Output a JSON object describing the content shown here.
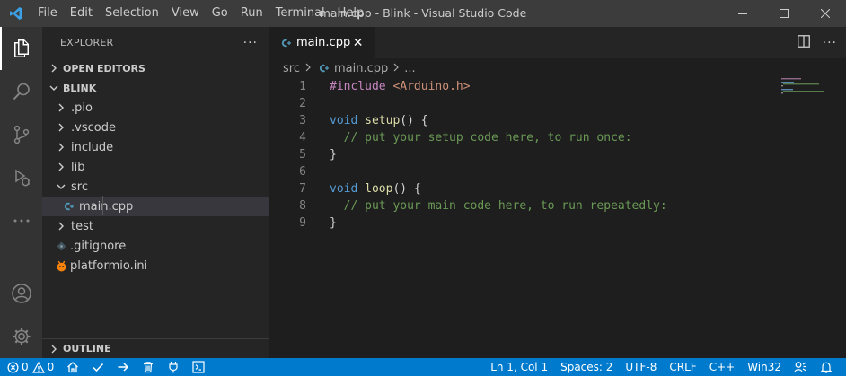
{
  "titlebar": {
    "menus": [
      "File",
      "Edit",
      "Selection",
      "View",
      "Go",
      "Run",
      "Terminal",
      "Help"
    ],
    "window_title": "main.cpp - Blink - Visual Studio Code"
  },
  "sidebar": {
    "title": "EXPLORER",
    "open_editors_label": "OPEN EDITORS",
    "workspace_label": "BLINK",
    "tree": [
      {
        "label": ".pio",
        "kind": "folder",
        "expanded": false,
        "depth": 1
      },
      {
        "label": ".vscode",
        "kind": "folder",
        "expanded": false,
        "depth": 1
      },
      {
        "label": "include",
        "kind": "folder",
        "expanded": false,
        "depth": 1
      },
      {
        "label": "lib",
        "kind": "folder",
        "expanded": false,
        "depth": 1
      },
      {
        "label": "src",
        "kind": "folder",
        "expanded": true,
        "depth": 1
      },
      {
        "label": "main.cpp",
        "kind": "cpp-file",
        "selected": true,
        "depth": 2
      },
      {
        "label": "test",
        "kind": "folder",
        "expanded": false,
        "depth": 1
      },
      {
        "label": ".gitignore",
        "kind": "gitignore-file",
        "depth": 1
      },
      {
        "label": "platformio.ini",
        "kind": "platformio-file",
        "depth": 1
      }
    ],
    "outline_label": "OUTLINE"
  },
  "editor": {
    "tab_label": "main.cpp",
    "breadcrumb": {
      "folder": "src",
      "file": "main.cpp",
      "tail": "..."
    },
    "lines": [
      {
        "n": "1",
        "text": "#include <Arduino.h>"
      },
      {
        "n": "2",
        "text": ""
      },
      {
        "n": "3",
        "text": "void setup() {"
      },
      {
        "n": "4",
        "text": "  // put your setup code here, to run once:"
      },
      {
        "n": "5",
        "text": "}"
      },
      {
        "n": "6",
        "text": ""
      },
      {
        "n": "7",
        "text": "void loop() {"
      },
      {
        "n": "8",
        "text": "  // put your main code here, to run repeatedly:"
      },
      {
        "n": "9",
        "text": "}"
      }
    ]
  },
  "statusbar": {
    "errors": "0",
    "warnings": "0",
    "cursor": "Ln 1, Col 1",
    "spaces": "Spaces: 2",
    "encoding": "UTF-8",
    "eol": "CRLF",
    "language": "C++",
    "platform": "Win32"
  },
  "colors": {
    "accent": "#007acc",
    "titlebar": "#3c3c3c",
    "activitybar": "#333333",
    "sidebar": "#252526",
    "editor": "#1e1e1e",
    "keyword": "#569cd6",
    "function": "#dcdcaa",
    "comment": "#6a9955",
    "string": "#ce9178",
    "preprocessor": "#c586c0"
  }
}
